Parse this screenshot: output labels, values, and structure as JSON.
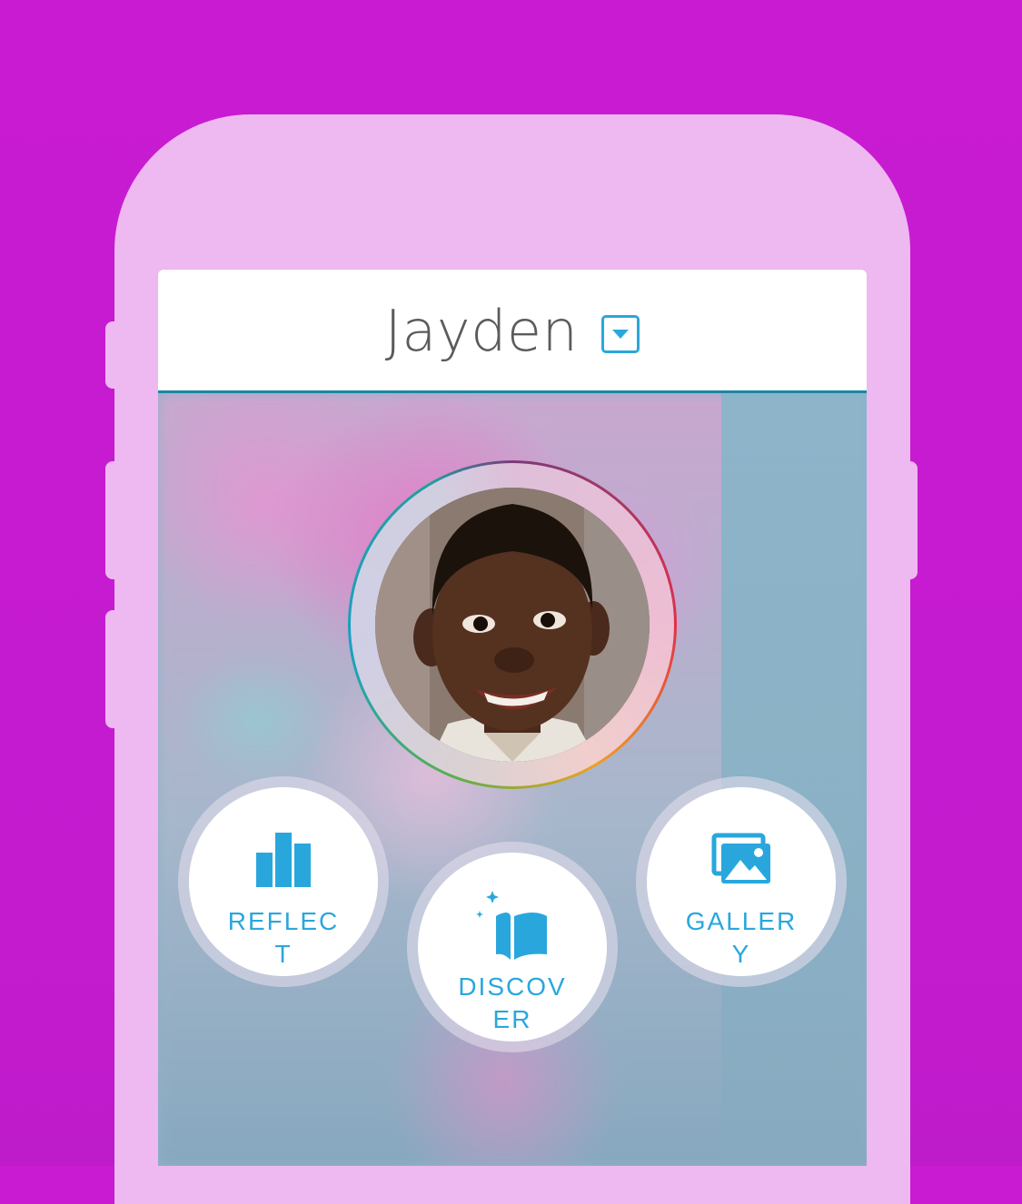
{
  "header": {
    "child_name": "Jayden"
  },
  "actions": [
    {
      "label": "REFLECT",
      "icon": "bar-chart-icon"
    },
    {
      "label": "DISCOVER",
      "icon": "open-book-icon"
    },
    {
      "label": "GALLERY",
      "icon": "photos-icon"
    }
  ],
  "colors": {
    "background": "#c81bd2",
    "phone_frame": "#eeb8f0",
    "accent": "#29a7dd",
    "header_text": "#5b5b5b"
  }
}
